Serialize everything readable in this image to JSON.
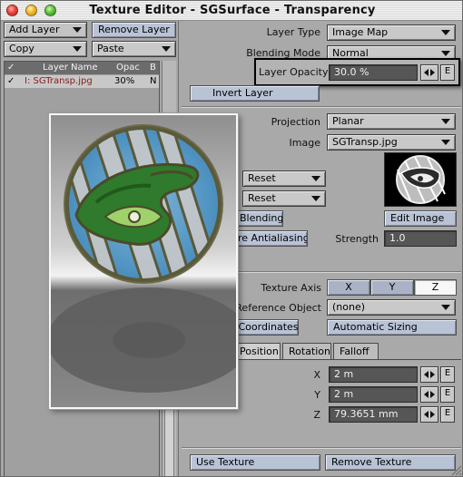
{
  "window": {
    "title": "Texture Editor - SGSurface - Transparency"
  },
  "left": {
    "add_layer": "Add Layer",
    "remove_layer": "Remove Layer",
    "copy": "Copy",
    "paste": "Paste",
    "columns": {
      "check": "✓",
      "name": "Layer Name",
      "opacity": "Opac",
      "blend": "B"
    },
    "layers": [
      {
        "check": "✓",
        "name": "I: SGTransp.jpg",
        "opacity": "30%",
        "blend": "N"
      }
    ]
  },
  "right": {
    "layer_type_label": "Layer Type",
    "layer_type_value": "Image Map",
    "blending_mode_label": "Blending Mode",
    "blending_mode_value": "Normal",
    "layer_opacity_label": "Layer Opacity",
    "layer_opacity_value": "30.0 %",
    "e": "E",
    "invert_layer": "Invert Layer",
    "projection_label": "Projection",
    "projection_value": "Planar",
    "image_label": "Image",
    "image_value": "SGTransp.jpg",
    "reset_1": "Reset",
    "reset_2": "Reset",
    "blending_btn": "Blending",
    "edit_image": "Edit Image",
    "antialiasing_btn": "re Antialiasing",
    "strength_label": "Strength",
    "strength_value": "1.0",
    "texture_axis_label": "Texture Axis",
    "axis_x": "X",
    "axis_y": "Y",
    "axis_z": "Z",
    "reference_object_label": "Reference Object",
    "reference_object_value": "(none)",
    "coordinates_btn": "d Coordinates",
    "automatic_sizing": "Automatic Sizing",
    "tabs": [
      "Position",
      "Rotation",
      "Falloff"
    ],
    "pos_x_label": "X",
    "pos_x_value": "2 m",
    "pos_y_label": "Y",
    "pos_y_value": "2 m",
    "pos_z_label": "Z",
    "pos_z_value": "79.3651 mm",
    "use_texture": "Use Texture",
    "remove_texture": "Remove Texture"
  }
}
